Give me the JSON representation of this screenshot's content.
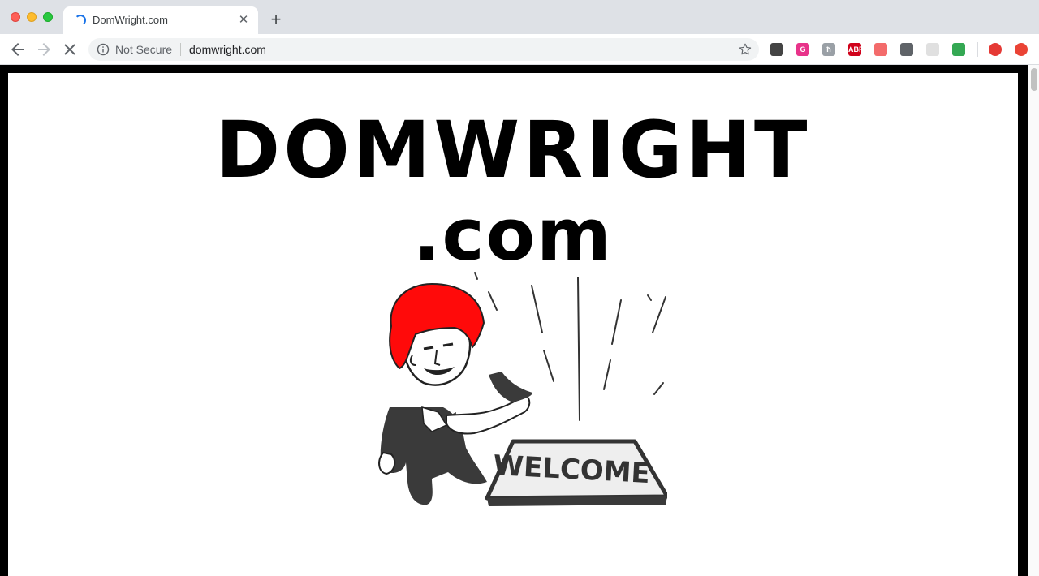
{
  "browser": {
    "tab": {
      "title": "DomWright.com"
    },
    "new_tab_label": "+",
    "tab_close_label": "✕",
    "omnibox": {
      "security_label": "Not Secure",
      "url": "domwright.com"
    },
    "extensions": [
      {
        "name": "extension-1-icon",
        "label": "",
        "color": "#444444"
      },
      {
        "name": "extension-g-icon",
        "label": "G",
        "color": "#e8338a"
      },
      {
        "name": "extension-grey-icon",
        "label": "ħ",
        "color": "#9aa0a6"
      },
      {
        "name": "adblock-icon",
        "label": "ABP",
        "color": "#d0021b"
      },
      {
        "name": "extension-arrow-icon",
        "label": "",
        "color": "#f36b6b"
      },
      {
        "name": "extension-code-icon",
        "label": "",
        "color": "#5f6368"
      },
      {
        "name": "extension-light-icon",
        "label": "",
        "color": "#e0e0e0"
      },
      {
        "name": "extension-picture-icon",
        "label": "",
        "color": "#34a853"
      },
      {
        "name": "profile-avatar-icon",
        "label": "",
        "color": "#e53935"
      },
      {
        "name": "extension-red-circle-icon",
        "label": "",
        "color": "#ea4335"
      }
    ]
  },
  "page": {
    "headline_line1": "DOMWRIGHT",
    "headline_line2": ".com",
    "mascot_sign_text": "WELCOME"
  }
}
